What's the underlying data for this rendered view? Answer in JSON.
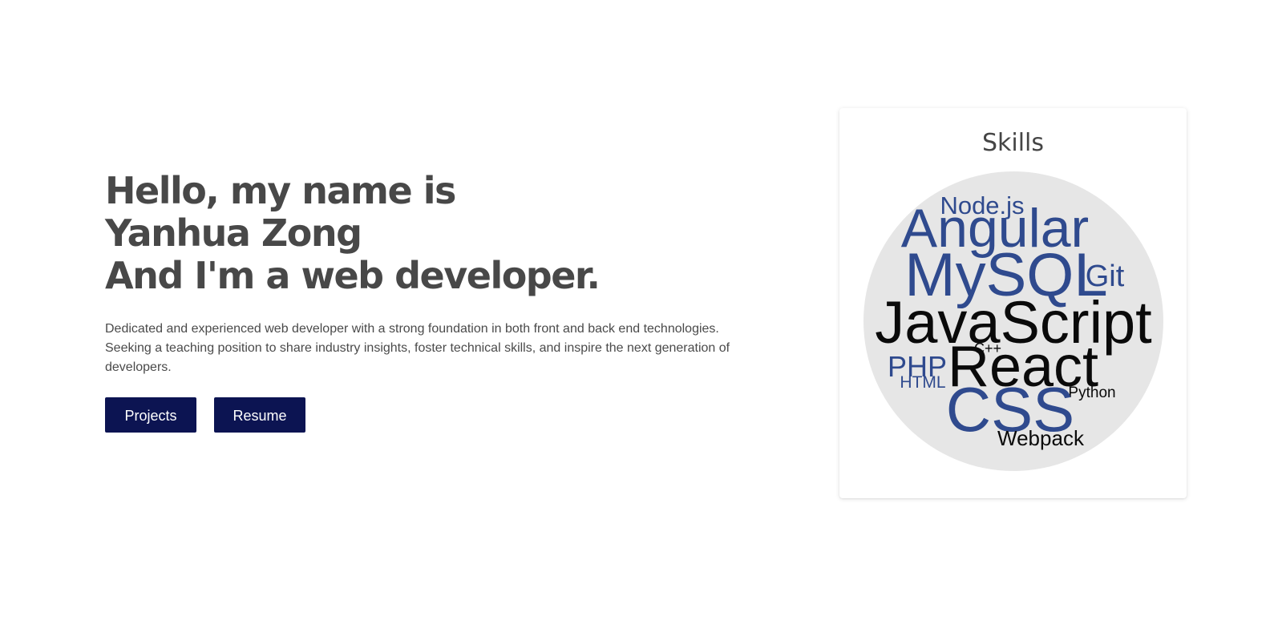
{
  "hero": {
    "headline": [
      "Hello, my name is",
      "Yanhua Zong",
      "And I'm a web developer."
    ],
    "intro": "Dedicated and experienced web developer with a strong foundation in both front and back end technologies. Seeking a teaching position to share industry insights, foster technical skills, and inspire the next generation of developers.",
    "buttons": {
      "projects": "Projects",
      "resume": "Resume"
    }
  },
  "skills": {
    "title": "Skills",
    "words": [
      "Node.js",
      "Angular",
      "MySQL",
      "Git",
      "JavaScript",
      "C++",
      "PHP",
      "React",
      "HTML",
      "Python",
      "CSS",
      "Webpack"
    ]
  },
  "colors": {
    "button_bg": "#0c1452",
    "button_text": "#ffffff",
    "word_blue": "#2f4a8e",
    "word_black": "#0a0a0a",
    "cloud_bg": "#e6e6e6",
    "text": "#454545"
  }
}
